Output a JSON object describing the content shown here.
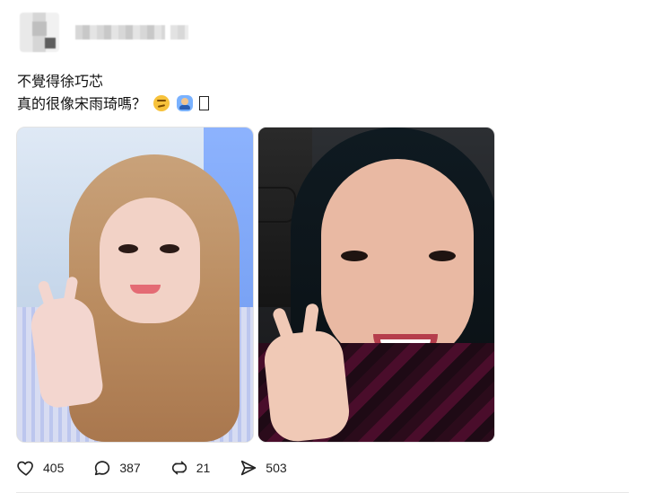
{
  "post": {
    "text_lines": [
      "不覺得徐巧芯",
      "真的很像宋雨琦嗎？"
    ],
    "emoji": {
      "first": "thinking-face",
      "second": "person-raising-hand",
      "third": "missing-glyph"
    }
  },
  "stats": {
    "likes": "405",
    "comments": "387",
    "reposts": "21",
    "shares": "503"
  }
}
